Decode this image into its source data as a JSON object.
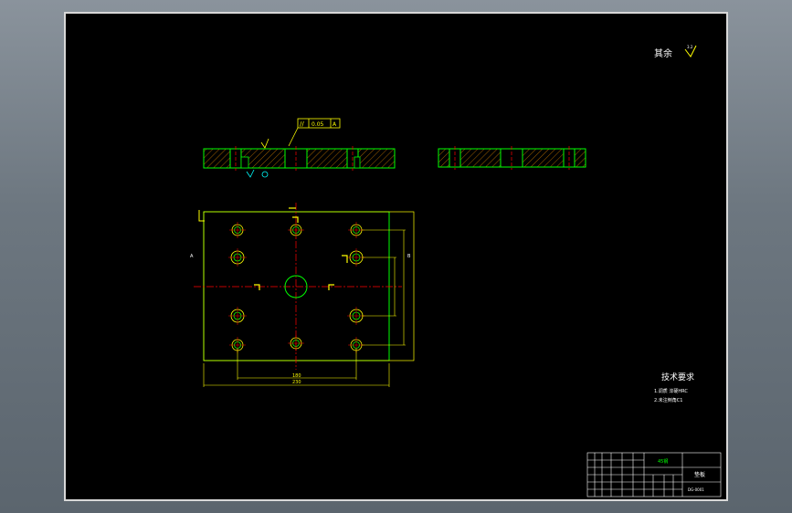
{
  "drawing": {
    "top_note_label": "其余",
    "roughness_symbol": "3.2",
    "datum_callout": {
      "symbol": "//",
      "tolerance": "0.05",
      "datum": "A"
    },
    "section_mark_left": "A",
    "section_mark_right": "B",
    "tech_requirements": {
      "title": "技术要求",
      "items": [
        "1.调质 淬硬HRC",
        "2.未注倒角C1"
      ]
    },
    "plan_dimensions": {
      "inner_width": "180",
      "outer_width": "230"
    },
    "title_block": {
      "part_name": "垫板",
      "material": "45钢",
      "drawing_number": "DG-0001"
    }
  },
  "colors": {
    "outline": "#00ff00",
    "dimension": "#ffff00",
    "centerline": "#ff0000",
    "hatch": "#c87800",
    "text": "#ffffff"
  }
}
